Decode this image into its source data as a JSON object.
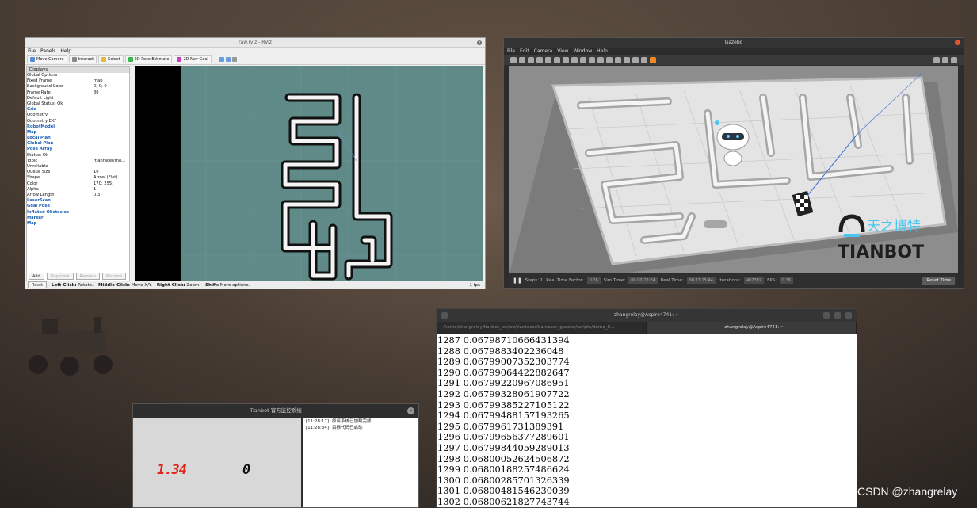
{
  "rviz": {
    "title": "raw.rviz - RViz",
    "menu": [
      "File",
      "Panels",
      "Help"
    ],
    "toolbar": [
      {
        "label": "Move Camera",
        "icon": "camera-icon"
      },
      {
        "label": "Interact",
        "icon": "interact-icon"
      },
      {
        "label": "Select",
        "icon": "select-icon"
      },
      {
        "label": "2D Pose Estimate",
        "icon": "pose-estimate-icon"
      },
      {
        "label": "2D Nav Goal",
        "icon": "nav-goal-icon"
      }
    ],
    "displays_header": "Displays",
    "rows": [
      {
        "name": "Global Options",
        "value": "",
        "blue": false
      },
      {
        "name": "Fixed Frame",
        "value": "map",
        "blue": false
      },
      {
        "name": "Background Color",
        "value": "0; 0; 0",
        "blue": false
      },
      {
        "name": "Frame Rate",
        "value": "30",
        "blue": false
      },
      {
        "name": "Default Light",
        "value": "",
        "blue": false
      },
      {
        "name": "Global Status: Ok",
        "value": "",
        "blue": false
      },
      {
        "name": "Grid",
        "value": "",
        "blue": true
      },
      {
        "name": "Odometry",
        "value": "",
        "blue": false
      },
      {
        "name": "Odometry EKF",
        "value": "",
        "blue": false
      },
      {
        "name": "RobotModel",
        "value": "",
        "blue": true
      },
      {
        "name": "Map",
        "value": "",
        "blue": true
      },
      {
        "name": "Local Plan",
        "value": "",
        "blue": true
      },
      {
        "name": "Global Plan",
        "value": "",
        "blue": true
      },
      {
        "name": "Pose Array",
        "value": "",
        "blue": true
      },
      {
        "name": "Status: Ok",
        "value": "",
        "blue": false
      },
      {
        "name": "Topic",
        "value": "/tianracer/mo...",
        "blue": false
      },
      {
        "name": "Unreliable",
        "value": "",
        "blue": false
      },
      {
        "name": "Queue Size",
        "value": "10",
        "blue": false
      },
      {
        "name": "Shape",
        "value": "Arrow (Flat)",
        "blue": false
      },
      {
        "name": "Color",
        "value": "170; 255;",
        "blue": false
      },
      {
        "name": "Alpha",
        "value": "1",
        "blue": false
      },
      {
        "name": "Arrow Length",
        "value": "0.3",
        "blue": false
      },
      {
        "name": "LaserScan",
        "value": "",
        "blue": true
      },
      {
        "name": "Goal Pose",
        "value": "",
        "blue": true
      },
      {
        "name": "Inflated Obstacles",
        "value": "",
        "blue": true
      },
      {
        "name": "Marker",
        "value": "",
        "blue": true
      },
      {
        "name": "Map",
        "value": "",
        "blue": true
      }
    ],
    "buttons": {
      "add": "Add",
      "duplicate": "Duplicate",
      "remove": "Remove",
      "rename": "Rename"
    },
    "status": {
      "reset": "Reset",
      "hint_left": "Left-Click:",
      "hint_left_val": "Rotate.",
      "hint_mid": "Middle-Click:",
      "hint_mid_val": "Move X/Y.",
      "hint_right": "Right-Click:",
      "hint_right_val": "Zoom.",
      "hint_shift": "Shift:",
      "hint_shift_val": "More options.",
      "fps": "1 fps"
    }
  },
  "gazebo": {
    "title": "Gazebo",
    "menu": [
      "File",
      "Edit",
      "Camera",
      "View",
      "Window",
      "Help"
    ],
    "logo_text": "TIANBOT",
    "logo_cn": "天之博特",
    "bottom": {
      "steps": "Steps: 1",
      "rtf_label": "Real Time Factor:",
      "rtf": "0.26",
      "sim_label": "Sim Time:",
      "sim": "00 00:23:24",
      "real_label": "Real Time:",
      "real": "00 21:25:44",
      "iter_label": "Iterations:",
      "iter": "407397",
      "fps_label": "FPS:",
      "fps": "0.36",
      "reset": "Reset Time"
    }
  },
  "terminal": {
    "title": "zhangrelay@Aspire4741: ~",
    "tab_path": "/home/zhangrelay/tianbot_ws/src/tianracer/tianracer_gazebo/scripts/demo_0...",
    "tab_active": "zhangrelay@Aspire4741: ~",
    "lines": [
      "1287 0.06798710666431394",
      "1288 0.0679883402236048",
      "1289 0.06799007352303774",
      "1290 0.06799064422882647",
      "1291 0.06799220967086951",
      "1292 0.06799328061907722",
      "1293 0.06799385227105122",
      "1294 0.06799488157193265",
      "1295 0.0679961731389391",
      "1296 0.06799656377289601",
      "1297 0.06799844059289013",
      "1298 0.06800052624506872",
      "1299 0.06800188257486624",
      "1300 0.06800285701326339",
      "1301 0.06800481546230039",
      "1302 0.06800621827743744"
    ]
  },
  "monitor": {
    "title": "Tianbot 官方监控系统",
    "left_value": "1.34",
    "right_value": "0",
    "log": [
      {
        "time": "[11:28:17]",
        "msg": "原评系统已加载完成"
      },
      {
        "time": "[11:28:34]",
        "msg": "目标代码已启动"
      }
    ]
  },
  "watermark": "CSDN @zhangrelay",
  "colors": {
    "accent_blue": "#1a5fb4",
    "seg_red": "#e0261b",
    "gazebo_close": "#e0552c"
  }
}
